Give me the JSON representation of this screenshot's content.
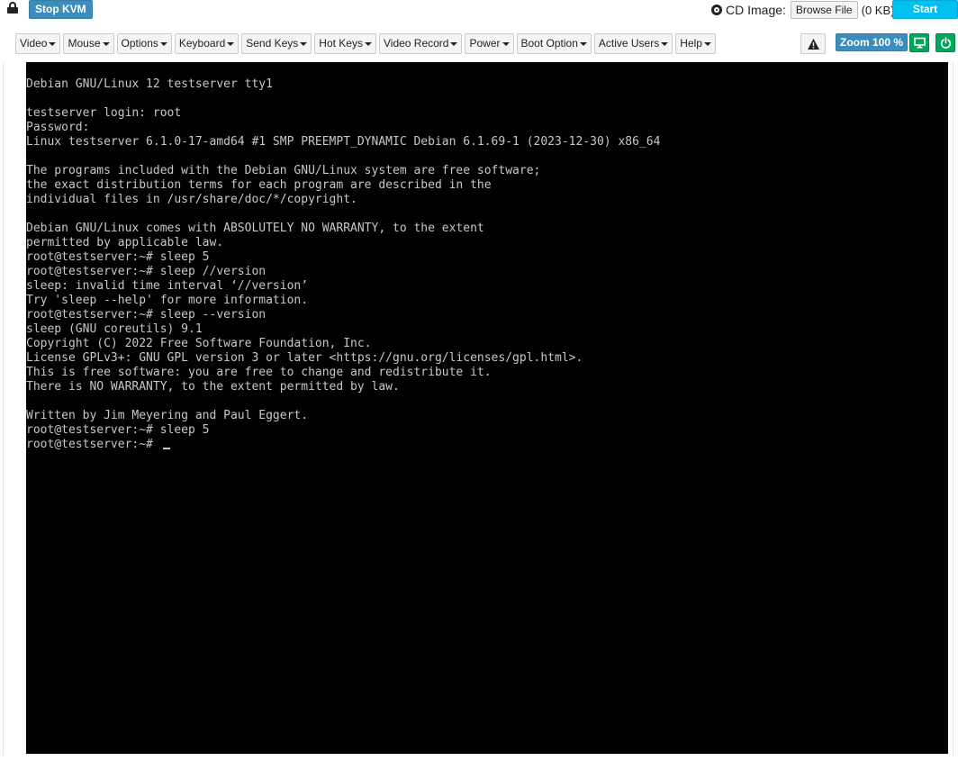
{
  "topbar": {
    "stop_kvm_label": "Stop KVM",
    "cd_image_label": "CD Image:",
    "browse_file_label": "Browse File",
    "file_size_text": "(0 KB)",
    "start_media_label": "Start Media"
  },
  "menu": {
    "items": [
      {
        "label": "Video"
      },
      {
        "label": "Mouse"
      },
      {
        "label": "Options"
      },
      {
        "label": "Keyboard"
      },
      {
        "label": "Send Keys"
      },
      {
        "label": "Hot Keys"
      },
      {
        "label": "Video Record"
      },
      {
        "label": "Power"
      },
      {
        "label": "Boot Option"
      },
      {
        "label": "Active Users"
      },
      {
        "label": "Help"
      }
    ],
    "zoom_label": "Zoom 100 %"
  },
  "icons": {
    "lock": "lock-icon",
    "cd": "disc-icon",
    "warning": "warning-icon",
    "display": "monitor-icon",
    "power": "power-icon"
  },
  "colors": {
    "primary_button": "#3c8dbc",
    "info_button": "#00c0ef",
    "success_button": "#00a65a",
    "console_bg": "#000000",
    "console_text": "#c8c8c8"
  },
  "console": {
    "lines": [
      "Debian GNU/Linux 12 testserver tty1",
      "",
      "testserver login: root",
      "Password:",
      "Linux testserver 6.1.0-17-amd64 #1 SMP PREEMPT_DYNAMIC Debian 6.1.69-1 (2023-12-30) x86_64",
      "",
      "The programs included with the Debian GNU/Linux system are free software;",
      "the exact distribution terms for each program are described in the",
      "individual files in /usr/share/doc/*/copyright.",
      "",
      "Debian GNU/Linux comes with ABSOLUTELY NO WARRANTY, to the extent",
      "permitted by applicable law.",
      "root@testserver:~# sleep 5",
      "root@testserver:~# sleep //version",
      "sleep: invalid time interval ‘//version’",
      "Try 'sleep --help' for more information.",
      "root@testserver:~# sleep --version",
      "sleep (GNU coreutils) 9.1",
      "Copyright (C) 2022 Free Software Foundation, Inc.",
      "License GPLv3+: GNU GPL version 3 or later <https://gnu.org/licenses/gpl.html>.",
      "This is free software: you are free to change and redistribute it.",
      "There is NO WARRANTY, to the extent permitted by law.",
      "",
      "Written by Jim Meyering and Paul Eggert.",
      "root@testserver:~# sleep 5",
      "root@testserver:~# "
    ]
  }
}
